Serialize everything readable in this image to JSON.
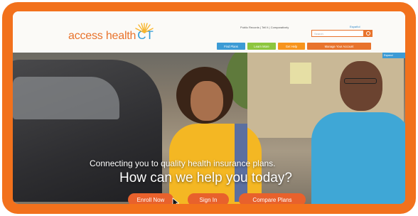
{
  "logo": {
    "main": "access health",
    "ct": "CT"
  },
  "header": {
    "utility_links": "Public Records | Tell It | Comparatively",
    "espanol_link": "Español",
    "search_placeholder": "Search"
  },
  "nav": [
    {
      "label": "Find Plans"
    },
    {
      "label": "Learn More"
    },
    {
      "label": "Get Help"
    },
    {
      "label": "Manage Your Account"
    }
  ],
  "side_tab": "Espanol",
  "hero": {
    "tagline": "Connecting you to quality health insurance plans.",
    "question": "How can we help you today?"
  },
  "cta": {
    "enroll": "Enroll Now",
    "signin": "Sign In",
    "compare": "Compare Plans"
  },
  "colors": {
    "frame": "#f2711c",
    "brand_orange": "#e8732c",
    "brand_blue": "#2e9bd6",
    "cta": "#e8612c"
  }
}
